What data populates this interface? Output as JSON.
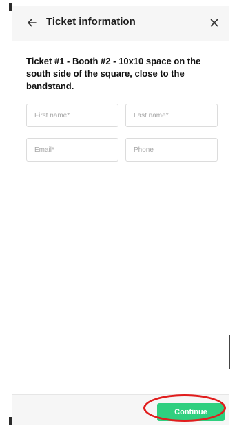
{
  "header": {
    "back_icon": "arrow-left-icon",
    "title": "Ticket information",
    "close_icon": "close-icon"
  },
  "ticket": {
    "description": "Ticket #1 - Booth #2 - 10x10 space on the south side of the square, close to the bandstand."
  },
  "form": {
    "first_name": {
      "placeholder": "First name*",
      "value": ""
    },
    "last_name": {
      "placeholder": "Last name*",
      "value": ""
    },
    "email": {
      "placeholder": "Email*",
      "value": ""
    },
    "phone": {
      "placeholder": "Phone",
      "value": ""
    }
  },
  "footer": {
    "continue_label": "Continue"
  },
  "colors": {
    "accent": "#2fcf7f",
    "highlight": "#e11d1d"
  }
}
